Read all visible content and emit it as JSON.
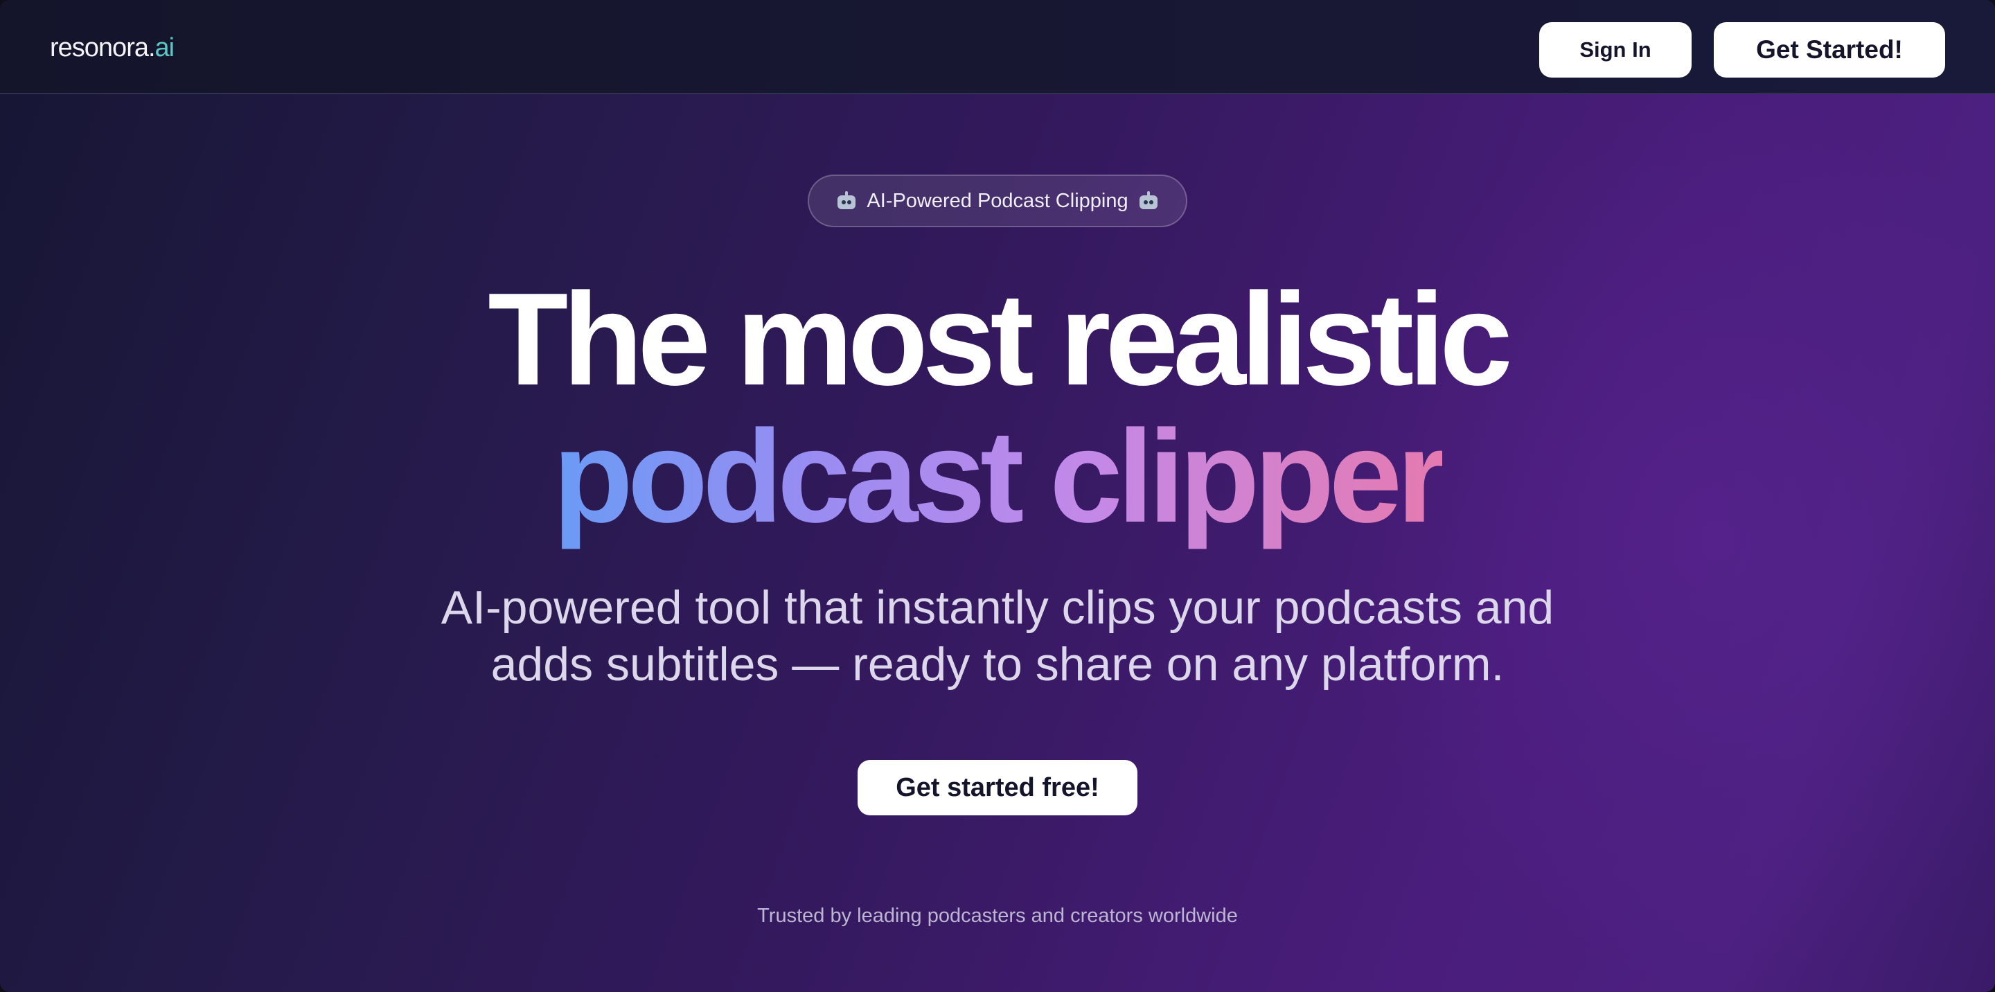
{
  "header": {
    "logo": {
      "main": "resonora.",
      "accent": "ai"
    },
    "sign_in_label": "Sign In",
    "get_started_label": "Get Started!"
  },
  "hero": {
    "badge_label": "AI-Powered Podcast Clipping",
    "badge_icon": "robot-icon",
    "headline_line1": "The most realistic",
    "headline_line2": "podcast clipper",
    "subtitle_line1": "AI-powered tool that instantly clips your podcasts and",
    "subtitle_line2": "adds subtitles — ready to share on any platform.",
    "cta_label": "Get started free!",
    "trusted_text": "Trusted by leading podcasters and creators worldwide"
  },
  "colors": {
    "logo_accent": "#5cc8c6",
    "headline_gradient_start": "#6a9bf5",
    "headline_gradient_end": "#e57ab0",
    "button_bg": "#ffffff"
  }
}
